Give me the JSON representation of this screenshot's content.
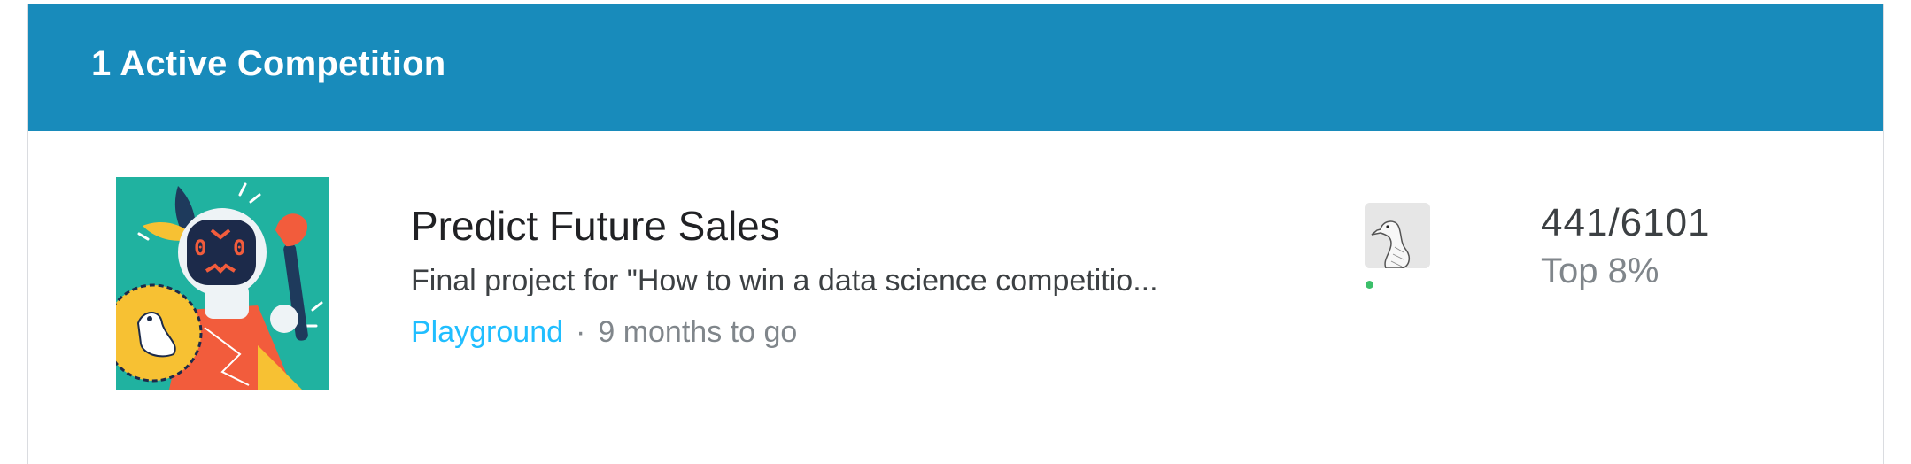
{
  "header": {
    "title": "1 Active Competition",
    "color": "#188bbb"
  },
  "competition": {
    "title": "Predict Future Sales",
    "description": "Final project for \"How to win a data science competitio...",
    "category": "Playground",
    "separator": "·",
    "deadline": "9 months to go",
    "thumbnail_icon": "robot-gladiator-thumbnail",
    "avatar_icon": "goose-avatar",
    "status": "online",
    "rank": "441/6101",
    "percentile": "Top 8%"
  },
  "colors": {
    "category_link": "#20beff",
    "online": "#3bbf6a",
    "thumbnail_bg": "#20b2a0"
  }
}
